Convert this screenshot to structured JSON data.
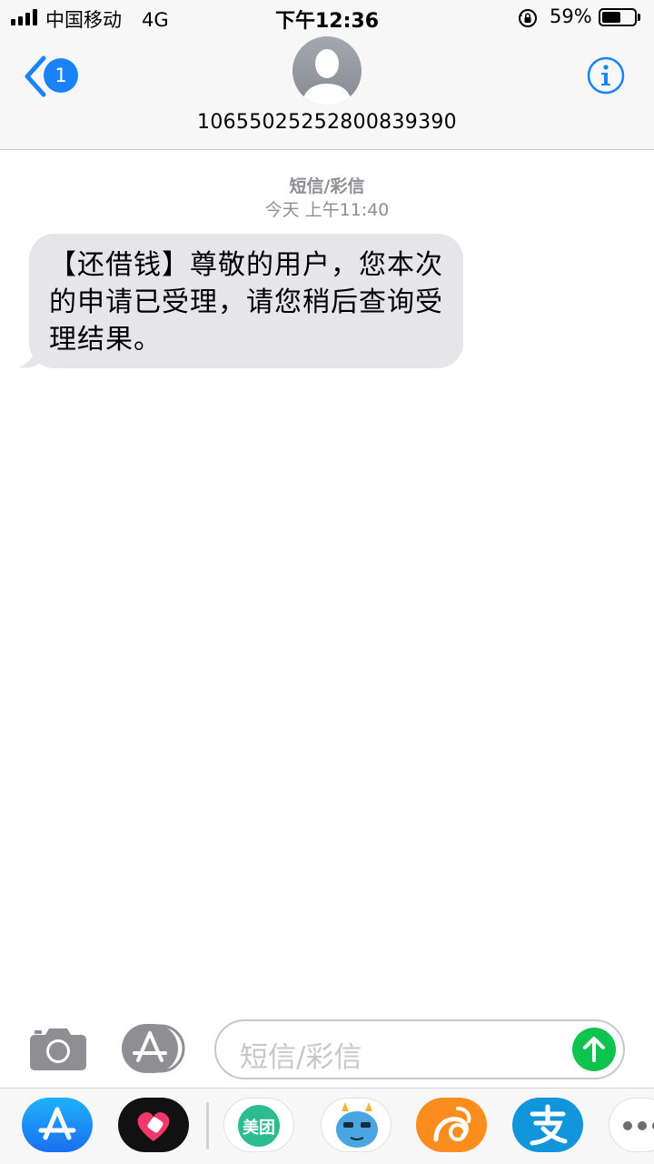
{
  "status_bar": {
    "carrier": "中国移动",
    "network": "4G",
    "time": "下午12:36",
    "battery_percent": "59%",
    "battery_level": 0.59
  },
  "header": {
    "back_badge": "1",
    "contact_number": "1065502525280083939​0"
  },
  "conversation": {
    "message_type": "短信/彩信",
    "timestamp": "今天 上午11:40",
    "messages": [
      {
        "direction": "incoming",
        "text": "【还借钱】尊敬的用户，您本次的申请已受理，请您稍后查询受理结果。"
      }
    ]
  },
  "input": {
    "placeholder": "短信/彩信"
  },
  "app_drawer": {
    "apps": [
      {
        "name": "app-store-icon"
      },
      {
        "name": "heart-app-icon"
      },
      {
        "name": "meituan-icon",
        "label": "美团"
      },
      {
        "name": "monster-app-icon"
      },
      {
        "name": "uc-browser-icon"
      },
      {
        "name": "alipay-icon"
      },
      {
        "name": "more-apps-icon"
      }
    ]
  },
  "colors": {
    "ios_blue": "#1a82fb",
    "bubble_gray": "#e5e5ea",
    "send_green": "#0fc34f",
    "meta_gray": "#8e8e93"
  }
}
